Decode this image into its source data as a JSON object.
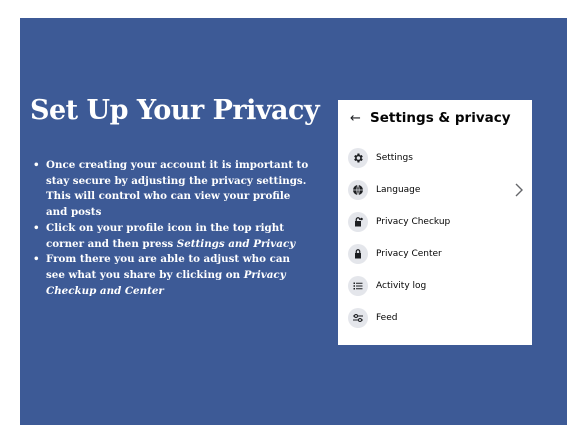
{
  "slide": {
    "title": "Set Up Your Privacy",
    "bullets": [
      {
        "text": "Once creating your account it is important to stay secure by adjusting the privacy settings. This will control who can view your profile and posts"
      },
      {
        "pre": "Click on your profile icon in the top right corner and then press ",
        "emph": "Settings and Privacy"
      },
      {
        "pre": "From there you are able to adjust who can see what you share by clicking on ",
        "emph": "Privacy Checkup and Center"
      }
    ]
  },
  "panel": {
    "back_icon": "back-arrow-icon",
    "title": "Settings & privacy",
    "items": [
      {
        "label": "Settings",
        "icon": "gear-icon"
      },
      {
        "label": "Language",
        "icon": "globe-icon",
        "has_chevron": true
      },
      {
        "label": "Privacy Checkup",
        "icon": "lock-icon"
      },
      {
        "label": "Privacy Center",
        "icon": "lock-icon"
      },
      {
        "label": "Activity log",
        "icon": "list-icon"
      },
      {
        "label": "Feed",
        "icon": "sliders-icon"
      }
    ]
  },
  "colors": {
    "slide_background": "#3d5a96",
    "text": "#ffffff",
    "panel_background": "#ffffff",
    "icon_background": "#e4e6eb"
  }
}
